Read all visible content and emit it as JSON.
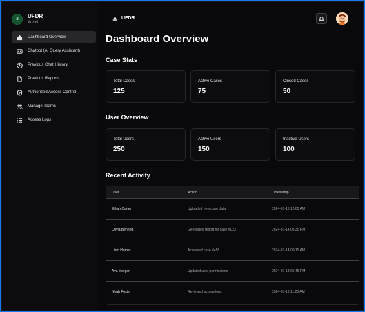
{
  "sidebar": {
    "logo_glyph": "3",
    "title": "UFDR",
    "subtitle": "Admin",
    "items": [
      {
        "label": "Dashboard Overview",
        "icon": "home-icon",
        "active": true
      },
      {
        "label": "Chatbot (AI Query Assistant)",
        "icon": "chatbot-icon",
        "active": false
      },
      {
        "label": "Previous Chat History",
        "icon": "history-icon",
        "active": false
      },
      {
        "label": "Previous Reports",
        "icon": "document-icon",
        "active": false
      },
      {
        "label": "Authorized Access Control",
        "icon": "shield-icon",
        "active": false
      },
      {
        "label": "Manage Teams",
        "icon": "team-icon",
        "active": false
      },
      {
        "label": "Access Logs",
        "icon": "list-icon",
        "active": false
      }
    ]
  },
  "topbar": {
    "brand": "UFDR"
  },
  "page": {
    "title": "Dashboard Overview"
  },
  "case_stats": {
    "title": "Case Stats",
    "cards": [
      {
        "label": "Total Cases",
        "value": "125"
      },
      {
        "label": "Active Cases",
        "value": "75"
      },
      {
        "label": "Closed Cases",
        "value": "50"
      }
    ]
  },
  "user_overview": {
    "title": "User Overview",
    "cards": [
      {
        "label": "Total Users",
        "value": "250"
      },
      {
        "label": "Active Users",
        "value": "150"
      },
      {
        "label": "Inactive Users",
        "value": "100"
      }
    ]
  },
  "recent_activity": {
    "title": "Recent Activity",
    "columns": [
      "User",
      "Action",
      "Timestamp"
    ],
    "rows": [
      [
        "Ethan Carter",
        "Uploaded new case data",
        "2024-01-15 10:00 AM"
      ],
      [
        "Olivia Bennett",
        "Generated report for case #123",
        "2024-01-14 03:30 PM"
      ],
      [
        "Liam Harper",
        "Accessed case #456",
        "2024-01-14 09:15 AM"
      ],
      [
        "Ava Morgan",
        "Updated user permissions",
        "2024-01-13 05:45 PM"
      ],
      [
        "Noah Foster",
        "Reviewed access logs",
        "2024-01-13 11:20 AM"
      ]
    ]
  },
  "colors": {
    "background": "#09090b",
    "active_nav": "#27272a",
    "border": "#27272a",
    "logo_green": "#14532d"
  }
}
